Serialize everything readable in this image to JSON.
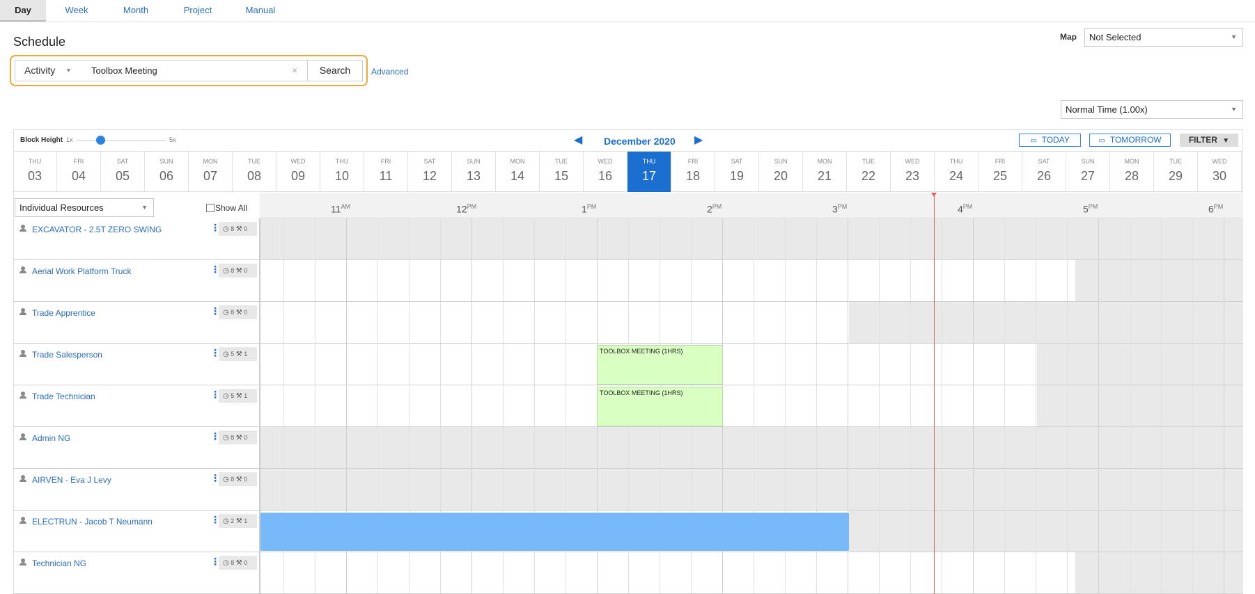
{
  "tabs": [
    {
      "label": "Day",
      "active": true
    },
    {
      "label": "Week",
      "active": false
    },
    {
      "label": "Month",
      "active": false
    },
    {
      "label": "Project",
      "active": false
    },
    {
      "label": "Manual",
      "active": false
    }
  ],
  "page_title": "Schedule",
  "map": {
    "label": "Map",
    "value": "Not Selected"
  },
  "search": {
    "type": "Activity",
    "value": "Toolbox Meeting",
    "button": "Search",
    "advanced": "Advanced"
  },
  "time_scale": {
    "value": "Normal Time (1.00x)"
  },
  "block_height": {
    "label": "Block Height",
    "min": "1x",
    "max": "5x",
    "level": 0.2
  },
  "month_label": "December 2020",
  "buttons": {
    "today": "TODAY",
    "tomorrow": "TOMORROW",
    "filter": "FILTER"
  },
  "days": [
    {
      "dow": "THU",
      "num": "03"
    },
    {
      "dow": "FRI",
      "num": "04"
    },
    {
      "dow": "SAT",
      "num": "05"
    },
    {
      "dow": "SUN",
      "num": "06"
    },
    {
      "dow": "MON",
      "num": "07"
    },
    {
      "dow": "TUE",
      "num": "08"
    },
    {
      "dow": "WED",
      "num": "09"
    },
    {
      "dow": "THU",
      "num": "10"
    },
    {
      "dow": "FRI",
      "num": "11"
    },
    {
      "dow": "SAT",
      "num": "12"
    },
    {
      "dow": "SUN",
      "num": "13"
    },
    {
      "dow": "MON",
      "num": "14"
    },
    {
      "dow": "TUE",
      "num": "15"
    },
    {
      "dow": "WED",
      "num": "16"
    },
    {
      "dow": "THU",
      "num": "17",
      "selected": true
    },
    {
      "dow": "FRI",
      "num": "18"
    },
    {
      "dow": "SAT",
      "num": "19"
    },
    {
      "dow": "SUN",
      "num": "20"
    },
    {
      "dow": "MON",
      "num": "21"
    },
    {
      "dow": "TUE",
      "num": "22"
    },
    {
      "dow": "WED",
      "num": "23"
    },
    {
      "dow": "THU",
      "num": "24"
    },
    {
      "dow": "FRI",
      "num": "25"
    },
    {
      "dow": "SAT",
      "num": "26"
    },
    {
      "dow": "SUN",
      "num": "27"
    },
    {
      "dow": "MON",
      "num": "28"
    },
    {
      "dow": "TUE",
      "num": "29"
    },
    {
      "dow": "WED",
      "num": "30"
    }
  ],
  "resource_filter": {
    "value": "Individual Resources",
    "show_all": "Show All"
  },
  "hours": [
    {
      "h": "11",
      "ampm": "AM"
    },
    {
      "h": "12",
      "ampm": "PM"
    },
    {
      "h": "1",
      "ampm": "PM"
    },
    {
      "h": "2",
      "ampm": "PM"
    },
    {
      "h": "3",
      "ampm": "PM"
    },
    {
      "h": "4",
      "ampm": "PM"
    },
    {
      "h": "5",
      "ampm": "PM"
    },
    {
      "h": "6",
      "ampm": "PM"
    }
  ],
  "resources": [
    {
      "name": "EXCAVATOR - 2.5T ZERO SWING",
      "hours": "8",
      "jobs": "0"
    },
    {
      "name": "Aerial Work Platform Truck",
      "hours": "8",
      "jobs": "0"
    },
    {
      "name": "Trade Apprentice",
      "hours": "8",
      "jobs": "0"
    },
    {
      "name": "Trade Salesperson",
      "hours": "5",
      "jobs": "1"
    },
    {
      "name": "Trade Technician",
      "hours": "5",
      "jobs": "1"
    },
    {
      "name": "Admin NG",
      "hours": "8",
      "jobs": "0"
    },
    {
      "name": "AIRVEN - Eva J Levy",
      "hours": "8",
      "jobs": "0"
    },
    {
      "name": "ELECTRUN - Jacob T Neumann",
      "hours": "2",
      "jobs": "1"
    },
    {
      "name": "Technician NG",
      "hours": "8",
      "jobs": "0"
    }
  ],
  "events": [
    {
      "label": "TOOLBOX MEETING (1HRS)"
    },
    {
      "label": "TOOLBOX MEETING (1HRS)"
    }
  ],
  "colors": {
    "accent": "#1a6fd1",
    "event_green": "#d9ffc2",
    "event_blue": "#77b9f9",
    "now_line": "#e86060",
    "search_outline": "#f0a830"
  }
}
